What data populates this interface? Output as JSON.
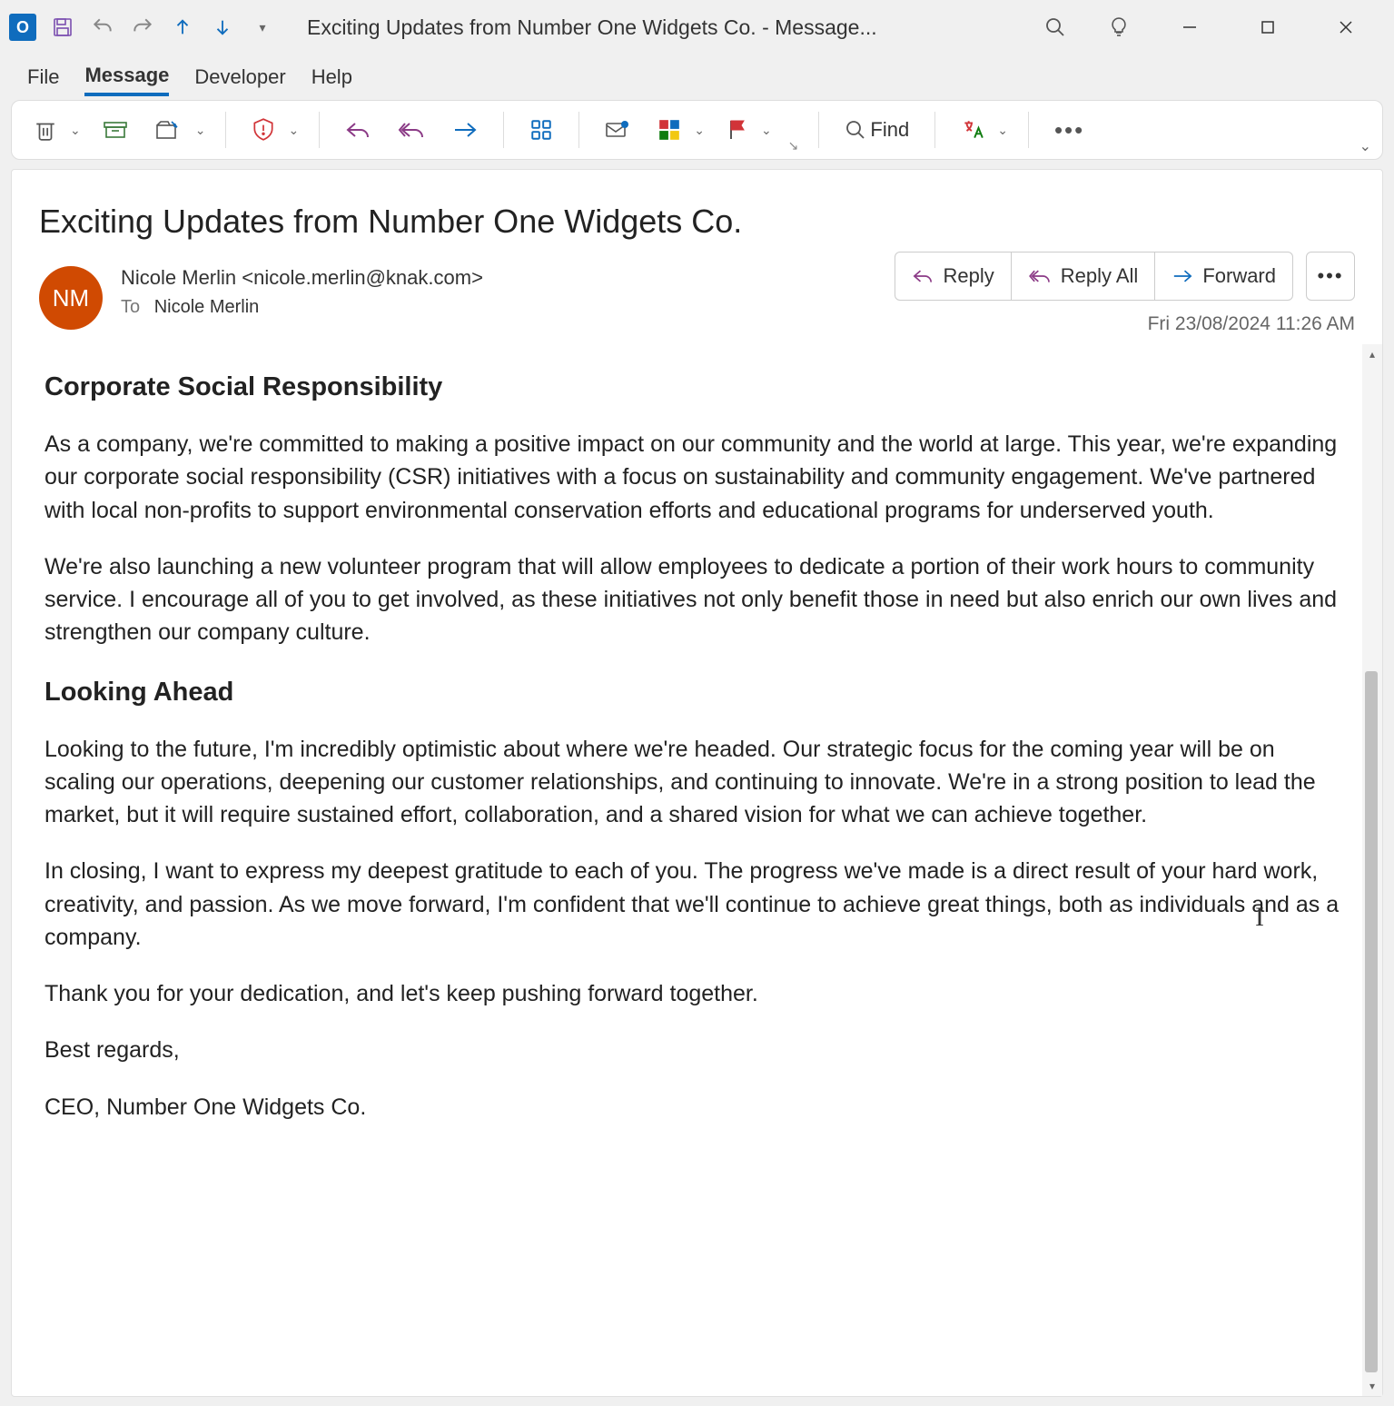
{
  "titlebar": {
    "title": "Exciting Updates from Number One Widgets Co.  -  Message..."
  },
  "menu": {
    "file": "File",
    "message": "Message",
    "developer": "Developer",
    "help": "Help"
  },
  "ribbon": {
    "find": "Find"
  },
  "message": {
    "subject": "Exciting Updates from Number One Widgets Co.",
    "avatar_initials": "NM",
    "from": "Nicole Merlin <nicole.merlin@knak.com>",
    "to_label": "To",
    "to_name": "Nicole Merlin",
    "actions": {
      "reply": "Reply",
      "reply_all": "Reply All",
      "forward": "Forward"
    },
    "timestamp": "Fri 23/08/2024 11:26 AM",
    "body": {
      "h_csr": "Corporate Social Responsibility",
      "p1": "As a company, we're committed to making a positive impact on our community and the world at large. This year, we're expanding our corporate social responsibility (CSR) initiatives with a focus on sustainability and community engagement. We've partnered with local non-profits to support environmental conservation efforts and educational programs for underserved youth.",
      "p2": "We're also launching a new volunteer program that will allow employees to dedicate a portion of their work hours to community service. I encourage all of you to get involved, as these initiatives not only benefit those in need but also enrich our own lives and strengthen our company culture.",
      "h_ahead": "Looking Ahead",
      "p3": "Looking to the future, I'm incredibly optimistic about where we're headed. Our strategic focus for the coming year will be on scaling our operations, deepening our customer relationships, and continuing to innovate. We're in a strong position to lead the market, but it will require sustained effort, collaboration, and a shared vision for what we can achieve together.",
      "p4": "In closing, I want to express my deepest gratitude to each of you. The progress we've made is a direct result of your hard work, creativity, and passion. As we move forward, I'm confident that we'll continue to achieve great things, both as individuals and as a company.",
      "p5": "Thank you for your dedication, and let's keep pushing forward together.",
      "p6": "Best regards,",
      "p7": "CEO, Number One Widgets Co."
    }
  }
}
